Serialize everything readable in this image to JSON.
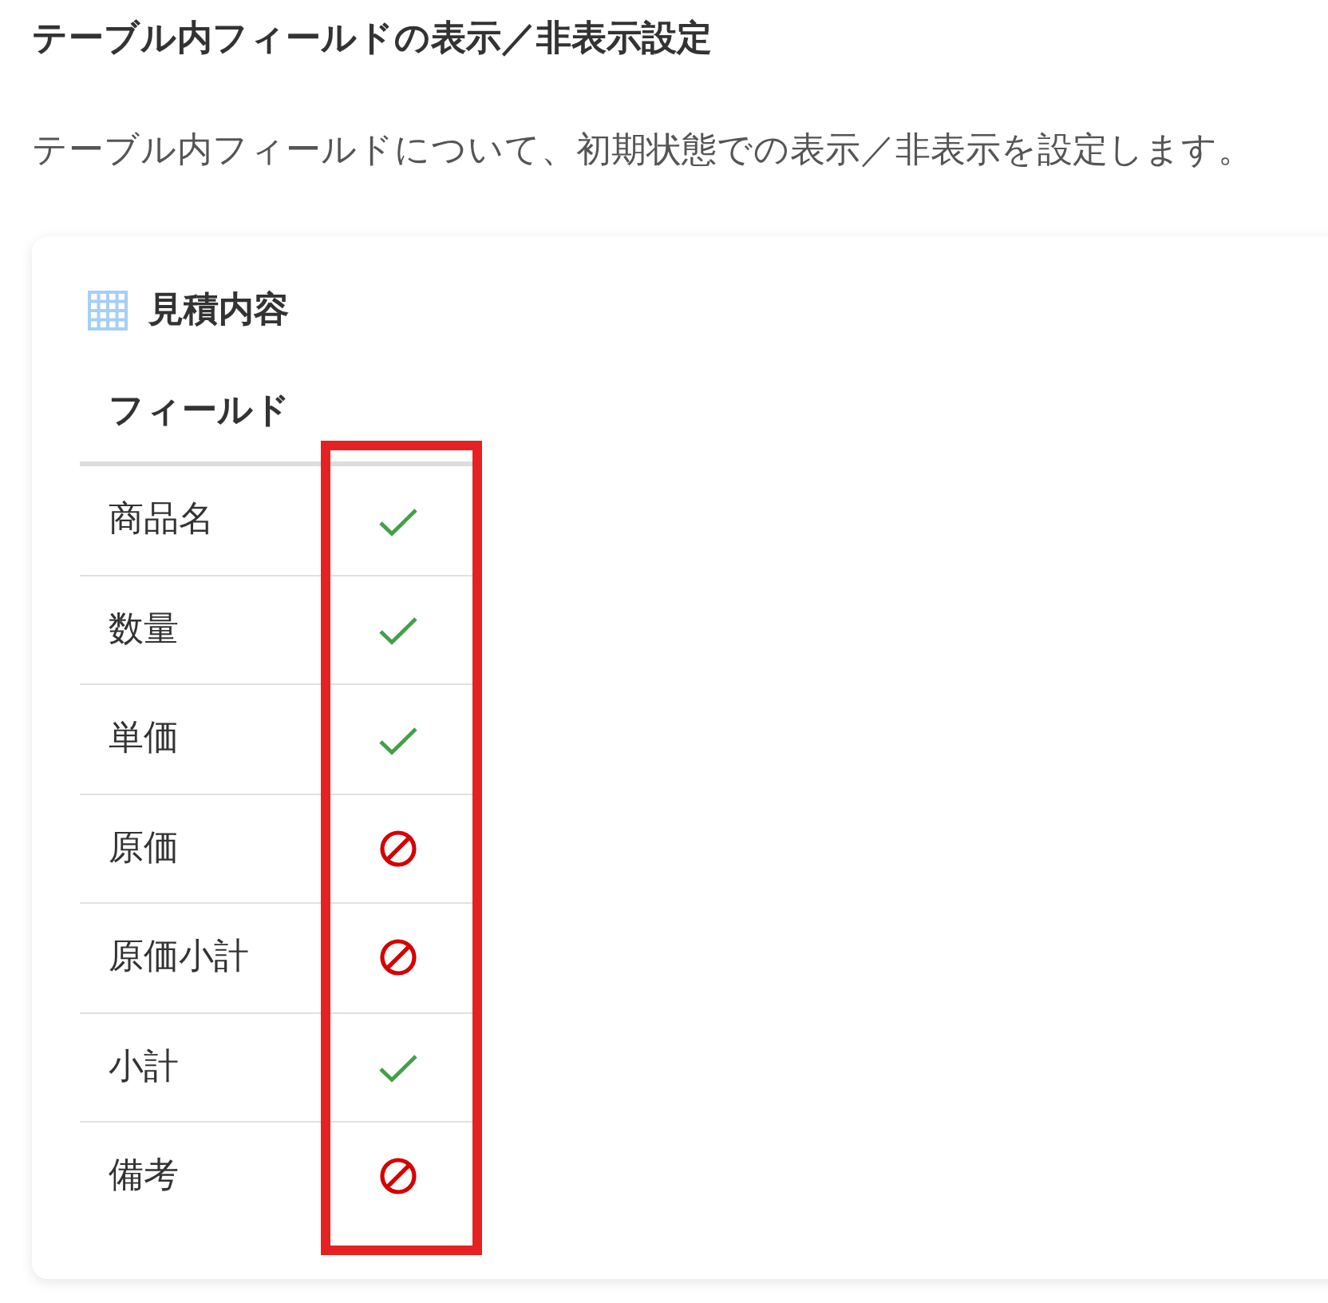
{
  "heading": "テーブル内フィールドの表示／非表示設定",
  "description": "テーブル内フィールドについて、初期状態での表示／非表示を設定します。",
  "card": {
    "title": "見積内容",
    "table": {
      "columns": [
        "フィールド"
      ],
      "rows": [
        {
          "field": "商品名",
          "visible": true
        },
        {
          "field": "数量",
          "visible": true
        },
        {
          "field": "単価",
          "visible": true
        },
        {
          "field": "原価",
          "visible": false
        },
        {
          "field": "原価小計",
          "visible": false
        },
        {
          "field": "小計",
          "visible": true
        },
        {
          "field": "備考",
          "visible": false
        }
      ]
    }
  }
}
